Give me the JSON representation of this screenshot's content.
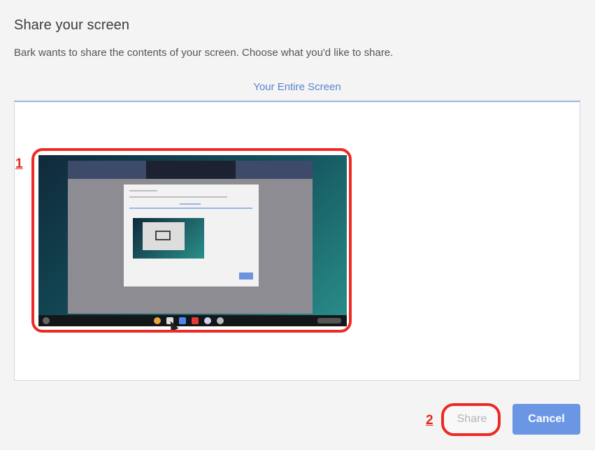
{
  "dialog": {
    "title": "Share your screen",
    "description": "Bark wants to share the contents of your screen. Choose what you'd like to share.",
    "tab_label": "Your Entire Screen"
  },
  "buttons": {
    "share_label": "Share",
    "cancel_label": "Cancel"
  },
  "annotations": {
    "marker_1": "1",
    "marker_2": "2"
  },
  "colors": {
    "accent": "#5a85cf",
    "highlight": "#ee2a24",
    "cancel_bg": "#6a96e4"
  }
}
